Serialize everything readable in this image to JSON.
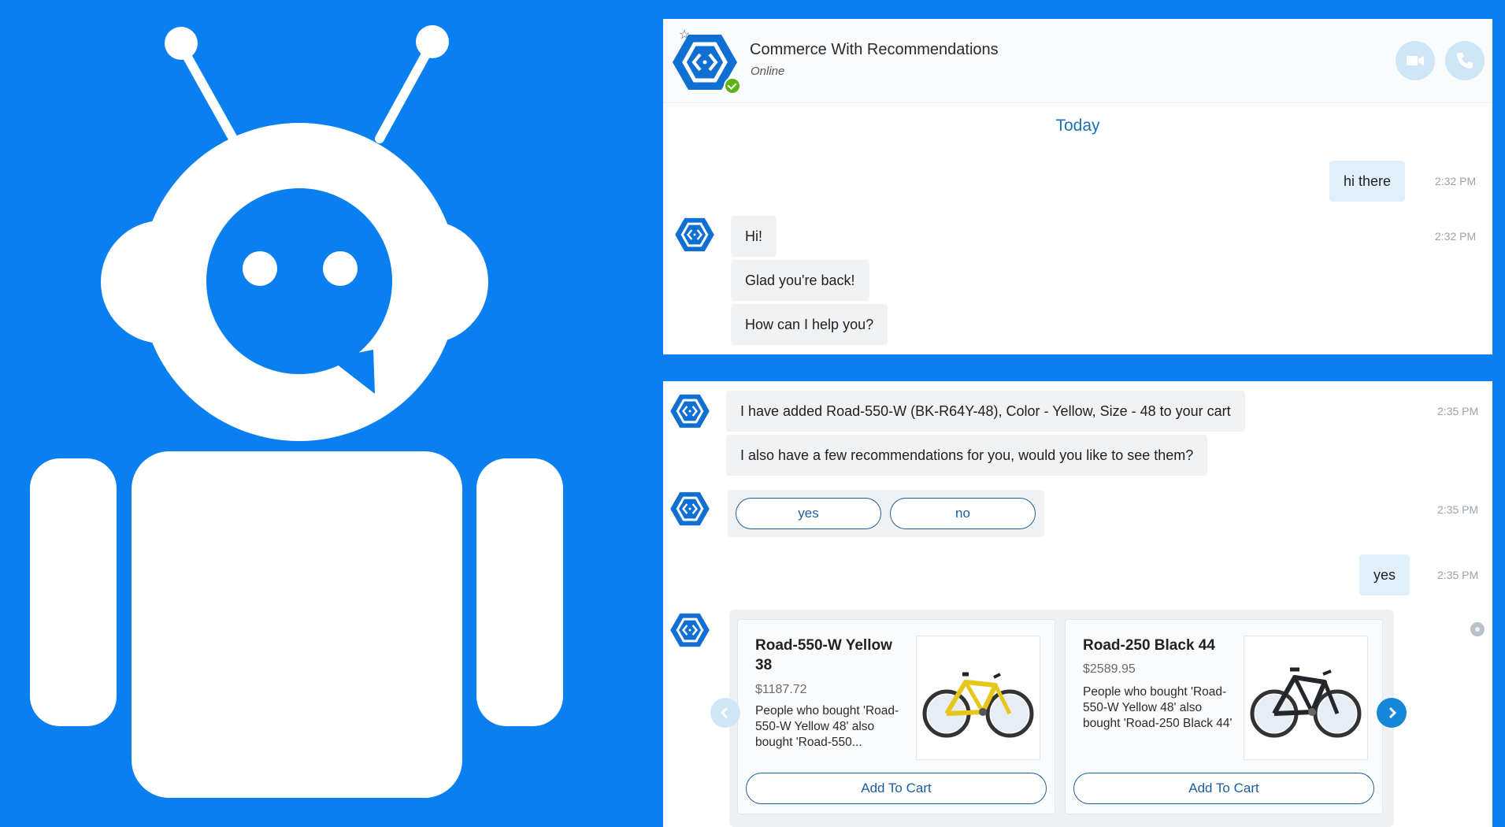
{
  "header": {
    "title": "Commerce With Recommendations",
    "status": "Online"
  },
  "chat": {
    "date_separator": "Today",
    "messages_top": [
      {
        "sender": "user",
        "text": "hi there",
        "time": "2:32 PM"
      },
      {
        "sender": "bot",
        "text": "Hi!",
        "time": "2:32 PM"
      },
      {
        "sender": "bot",
        "text": "Glad you're back!"
      },
      {
        "sender": "bot",
        "text": "How can I help you?"
      }
    ],
    "messages_bottom": [
      {
        "sender": "bot",
        "text": "I have added Road-550-W (BK-R64Y-48), Color - Yellow, Size - 48 to your cart",
        "time": "2:35 PM"
      },
      {
        "sender": "bot",
        "text": "I also have a few recommendations for you, would you like to see them?"
      },
      {
        "sender": "user",
        "text": "yes",
        "time": "2:35 PM"
      }
    ],
    "choices": {
      "yes": "yes",
      "no": "no",
      "time": "2:35 PM"
    },
    "cards": [
      {
        "title": "Road-550-W Yellow 38",
        "price": "$1187.72",
        "text": "People who bought 'Road-550-W Yellow 48' also bought 'Road-550...",
        "button": "Add To Cart",
        "image": "yellow-bike"
      },
      {
        "title": "Road-250 Black 44",
        "price": "$2589.95",
        "text": "People who bought 'Road-550-W Yellow 48' also bought 'Road-250 Black 44'",
        "button": "Add To Cart",
        "image": "black-bike"
      }
    ]
  },
  "icons": [
    "robot-logo",
    "bot-avatar-icon",
    "video-call-icon",
    "phone-icon",
    "star-icon",
    "online-check-icon",
    "chevron-left-icon",
    "chevron-right-icon"
  ],
  "colors": {
    "background": "#0a7ff0",
    "accent": "#1a5f9e",
    "link": "#1a6fb5",
    "online": "#5bb317",
    "user_bubble": "#dff0fb",
    "bot_bubble": "#f1f2f4"
  }
}
